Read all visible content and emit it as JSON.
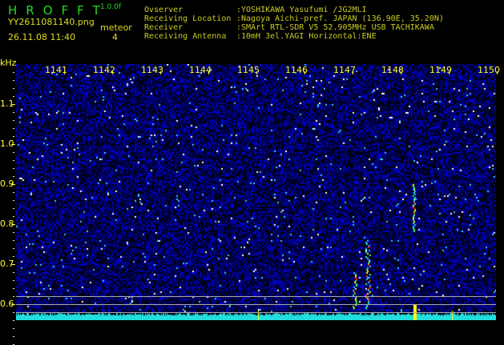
{
  "header": {
    "logo": "HROFFT",
    "version": "1.0.0f",
    "filename": "YY2611081140.png",
    "datetime": "26.11.08 11:40",
    "meteor_label": "meteor",
    "meteor_count": "4"
  },
  "info": [
    {
      "label": "Ovserver",
      "value": ":YOSHIKAWA Yasufumi /JG2MLI"
    },
    {
      "label": "Receiving Location",
      "value": ":Nagoya Aichi-pref. JAPAN (136.90E, 35.20N)"
    },
    {
      "label": "Receiver",
      "value": ":SMArt RTL-SDR V5 52.905MHz USB TACHIKAWA"
    },
    {
      "label": "Receiving Antenna",
      "value": ":10mH 3el.YAGI Horizontal:ENE"
    }
  ],
  "spectrogram": {
    "y_unit": "kHz",
    "x_labels": [
      "1141",
      "1142",
      "1143",
      "1144",
      "1145",
      "1146",
      "1147",
      "1148",
      "1149",
      "1150"
    ],
    "y_labels": [
      "1.1",
      "1.0",
      "0.9",
      "0.8",
      "0.7",
      "0.6"
    ],
    "colors": {
      "background": "#000022",
      "noise": "#2233dd",
      "baseline": "#22dddd",
      "text": "#ffff33"
    }
  }
}
